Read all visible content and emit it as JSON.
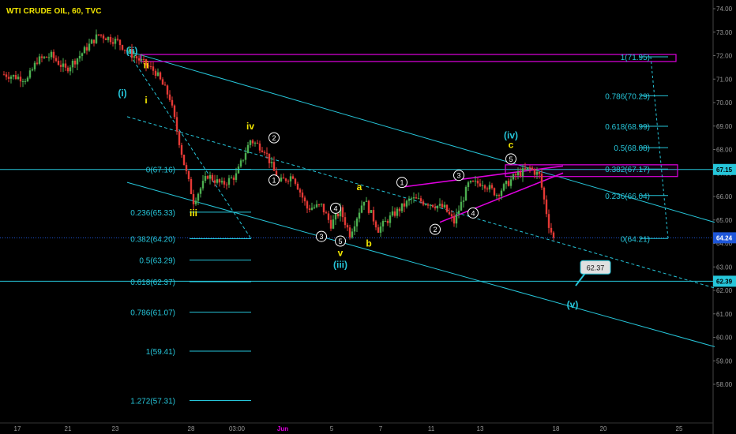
{
  "chart": {
    "title": "WTI CRUDE OIL, 60, TVC",
    "axis": {
      "y_ticks": [
        "74.00",
        "73.00",
        "72.00",
        "71.00",
        "70.00",
        "69.00",
        "68.00",
        "67.00",
        "66.00",
        "65.00",
        "64.00",
        "63.00",
        "62.00",
        "61.00",
        "60.00",
        "59.00",
        "58.00"
      ],
      "x_ticks": [
        "17",
        "21",
        "23",
        "28",
        "03:00",
        "Jun",
        "5",
        "7",
        "11",
        "13",
        "18",
        "20",
        "25"
      ],
      "price_tags": [
        {
          "label": "67.15",
          "value": 67.15,
          "style": "cyan"
        },
        {
          "label": "64.24",
          "value": 64.24,
          "style": "blue"
        },
        {
          "label": "62.39",
          "value": 62.39,
          "style": "cyan"
        }
      ]
    },
    "colors": {
      "background": "#000000",
      "up": "#4caf50",
      "down": "#e53935",
      "cyan": "#26c6da",
      "magenta": "#e000e0",
      "yellow": "#f2e600",
      "blue": "#1e56d8"
    }
  },
  "chart_data": {
    "type": "candlestick",
    "title": "WTI CRUDE OIL, 60, TVC",
    "ylim": [
      57.5,
      74.3
    ],
    "x_ticks": [
      "17",
      "21",
      "23",
      "28",
      "03:00",
      "Jun",
      "5",
      "7",
      "11",
      "13",
      "18",
      "20",
      "25"
    ],
    "price_path": [
      {
        "t": 0,
        "p": 71.2
      },
      {
        "t": 2.5,
        "p": 71.0
      },
      {
        "t": 3.5,
        "p": 71.8
      },
      {
        "t": 5,
        "p": 72.0
      },
      {
        "t": 6.5,
        "p": 71.4
      },
      {
        "t": 8,
        "p": 72.0
      },
      {
        "t": 10,
        "p": 72.9
      },
      {
        "t": 12,
        "p": 72.6
      },
      {
        "t": 13,
        "p": 72.2
      },
      {
        "t": 14,
        "p": 71.9
      },
      {
        "t": 16,
        "p": 71.3
      },
      {
        "t": 17.5,
        "p": 70.2
      },
      {
        "t": 19,
        "p": 67.4
      },
      {
        "t": 20,
        "p": 65.8
      },
      {
        "t": 21.5,
        "p": 66.9
      },
      {
        "t": 23,
        "p": 66.5
      },
      {
        "t": 24.5,
        "p": 66.9
      },
      {
        "t": 26,
        "p": 68.4
      },
      {
        "t": 27.5,
        "p": 68.0
      },
      {
        "t": 29,
        "p": 66.6
      },
      {
        "t": 30.5,
        "p": 66.9
      },
      {
        "t": 32,
        "p": 65.5
      },
      {
        "t": 33.5,
        "p": 65.6
      },
      {
        "t": 34.5,
        "p": 64.8
      },
      {
        "t": 35.5,
        "p": 65.4
      },
      {
        "t": 36.5,
        "p": 64.4
      },
      {
        "t": 38,
        "p": 65.9
      },
      {
        "t": 39.5,
        "p": 64.6
      },
      {
        "t": 41,
        "p": 65.2
      },
      {
        "t": 43,
        "p": 65.9
      },
      {
        "t": 45,
        "p": 65.7
      },
      {
        "t": 46.5,
        "p": 65.5
      },
      {
        "t": 47.5,
        "p": 64.9
      },
      {
        "t": 49,
        "p": 66.5
      },
      {
        "t": 50.5,
        "p": 66.6
      },
      {
        "t": 52,
        "p": 66.1
      },
      {
        "t": 54,
        "p": 66.9
      },
      {
        "t": 55.5,
        "p": 67.2
      },
      {
        "t": 56.5,
        "p": 66.9
      },
      {
        "t": 57.5,
        "p": 64.8
      },
      {
        "t": 58,
        "p": 64.2
      }
    ],
    "wave_labels": [
      {
        "text": "(ii)",
        "t": 13.5,
        "p": 72.2,
        "color": "cyan",
        "style": "plain"
      },
      {
        "text": "(i)",
        "t": 12.5,
        "p": 70.4,
        "color": "cyan",
        "style": "plain"
      },
      {
        "text": "ii",
        "t": 15,
        "p": 71.6,
        "color": "yellow",
        "style": "plain"
      },
      {
        "text": "i",
        "t": 15,
        "p": 70.1,
        "color": "yellow",
        "style": "plain"
      },
      {
        "text": "iii",
        "t": 20,
        "p": 65.3,
        "color": "yellow",
        "style": "plain"
      },
      {
        "text": "iv",
        "t": 26,
        "p": 69.0,
        "color": "yellow",
        "style": "plain"
      },
      {
        "text": "v",
        "t": 35.5,
        "p": 63.6,
        "color": "yellow",
        "style": "plain"
      },
      {
        "text": "(iii)",
        "t": 35.5,
        "p": 63.1,
        "color": "cyan",
        "style": "plain"
      },
      {
        "text": "a",
        "t": 37.5,
        "p": 66.4,
        "color": "yellow",
        "style": "plain"
      },
      {
        "text": "b",
        "t": 38.5,
        "p": 64.0,
        "color": "yellow",
        "style": "plain"
      },
      {
        "text": "c",
        "t": 53.5,
        "p": 68.2,
        "color": "yellow",
        "style": "plain"
      },
      {
        "text": "(iv)",
        "t": 53.5,
        "p": 68.6,
        "color": "cyan",
        "style": "plain"
      },
      {
        "text": "(v)",
        "t": 60,
        "p": 61.4,
        "color": "cyan",
        "style": "plain"
      },
      {
        "text": "1",
        "t": 28.5,
        "p": 66.7,
        "color": "white",
        "style": "circle"
      },
      {
        "text": "2",
        "t": 28.5,
        "p": 68.5,
        "color": "white",
        "style": "circle"
      },
      {
        "text": "3",
        "t": 33.5,
        "p": 64.3,
        "color": "white",
        "style": "circle"
      },
      {
        "text": "4",
        "t": 35,
        "p": 65.5,
        "color": "white",
        "style": "circle"
      },
      {
        "text": "5",
        "t": 35.5,
        "p": 64.1,
        "color": "white",
        "style": "circle"
      },
      {
        "text": "1",
        "t": 42,
        "p": 66.6,
        "color": "white",
        "style": "circle"
      },
      {
        "text": "2",
        "t": 45.5,
        "p": 64.6,
        "color": "white",
        "style": "circle"
      },
      {
        "text": "3",
        "t": 48,
        "p": 66.9,
        "color": "white",
        "style": "circle"
      },
      {
        "text": "4",
        "t": 49.5,
        "p": 65.3,
        "color": "white",
        "style": "circle"
      },
      {
        "text": "5",
        "t": 53.5,
        "p": 67.6,
        "color": "white",
        "style": "circle"
      }
    ],
    "fib_left": [
      {
        "label": "0(67.16)",
        "value": 67.16
      },
      {
        "label": "0.236(65.33)",
        "value": 65.33
      },
      {
        "label": "0.382(64.20)",
        "value": 64.2
      },
      {
        "label": "0.5(63.29)",
        "value": 63.29
      },
      {
        "label": "0.618(62.37)",
        "value": 62.37
      },
      {
        "label": "0.786(61.07)",
        "value": 61.07
      },
      {
        "label": "1(59.41)",
        "value": 59.41
      },
      {
        "label": "1.272(57.31)",
        "value": 57.31
      }
    ],
    "fib_right": [
      {
        "label": "1(71.95)",
        "value": 71.95
      },
      {
        "label": "0.786(70.29)",
        "value": 70.29
      },
      {
        "label": "0.618(68.99)",
        "value": 68.99
      },
      {
        "label": "0.5(68.08)",
        "value": 68.08
      },
      {
        "label": "0.382(67.17)",
        "value": 67.17
      },
      {
        "label": "0.236(66.04)",
        "value": 66.04
      },
      {
        "label": "0(64.21)",
        "value": 64.21
      }
    ],
    "channel_upper": [
      {
        "t": 13,
        "p": 72.2
      },
      {
        "t": 75,
        "p": 64.9
      }
    ],
    "channel_lower": [
      {
        "t": 13,
        "p": 66.6
      },
      {
        "t": 75,
        "p": 59.6
      }
    ],
    "channel_mid": [
      {
        "t": 13,
        "p": 69.4
      },
      {
        "t": 75,
        "p": 62.1
      }
    ],
    "target_callout": {
      "label": "62.37",
      "t": 61.5,
      "p": 63.0
    },
    "h_lines": [
      {
        "value": 67.15,
        "style": "cyan-solid"
      },
      {
        "value": 64.24,
        "style": "blue-dotted"
      },
      {
        "value": 62.39,
        "style": "cyan-solid"
      }
    ]
  }
}
